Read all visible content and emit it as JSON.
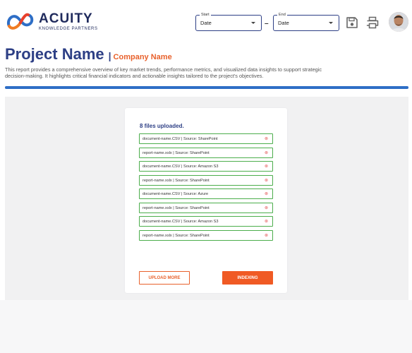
{
  "header": {
    "brand": "ACUITY",
    "brand_sub": "KNOWLEDGE PARTNERS",
    "start_label": "Start",
    "start_value": "Date",
    "end_label": "End",
    "end_value": "Date",
    "date_separator": "–",
    "icons": [
      "save-icon",
      "print-icon"
    ]
  },
  "page": {
    "title": "Project Name",
    "separator": "|",
    "company": "Company Name",
    "description": "This report provides a comprehensive overview of key market trends, performance metrics, and visualized data insights to support strategic decision-making. It highlights critical financial indicators and actionable insights tailored to the project's objectives.",
    "progress_fraction": 1.0
  },
  "upload": {
    "heading": "8 files uploaded.",
    "files": [
      "document-name.CSV  |  Source: SharePoint",
      "report-name.xslx  |  Source: SharePoint",
      "document-name.CSV  |  Source: Amazon S3",
      "report-name.xslx  |  Source: SharePoint",
      "document-name.CSV  |  Source: Azure",
      "report-name.xslx  |  Source: SharePoint",
      "document-name.CSV  |  Source: Amazon S3",
      "report-name.xslx  |  Source: SharePoint"
    ],
    "remove_glyph": "⊗",
    "upload_more_label": "UPLOAD MORE",
    "indexing_label": "INDEXING"
  },
  "colors": {
    "primary": "#2d3f85",
    "accent": "#e8612c",
    "progress": "#2e6ec6",
    "file_border": "#4cae4c"
  }
}
